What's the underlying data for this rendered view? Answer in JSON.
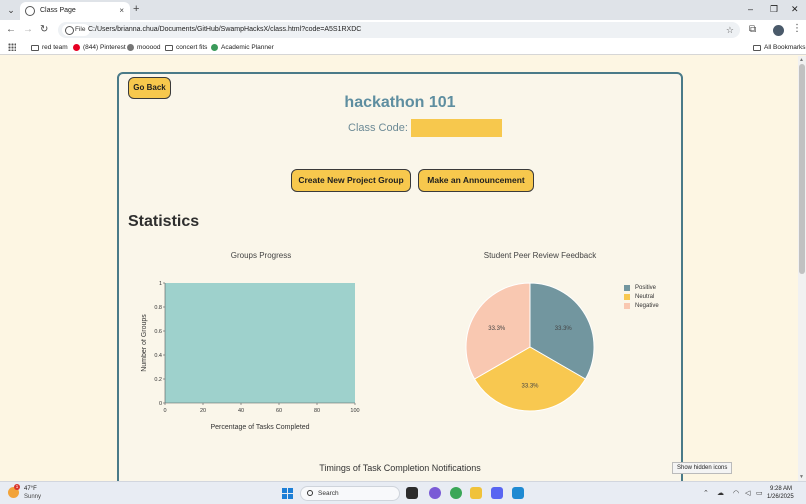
{
  "browser": {
    "tab_title": "Class Page",
    "new_tab": "+",
    "tab_close": "×",
    "url_scheme_label": "File",
    "url": "C:/Users/brianna.chua/Documents/GitHub/SwampHacksX/class.html?code=A5S1RXDC",
    "window_controls": [
      "–",
      "❐",
      "✕"
    ],
    "bookmarks": [
      "red team",
      "(844) Pinterest",
      "mooood",
      "concert fits",
      "Academic Planner"
    ],
    "all_bookmarks": "All Bookmarks"
  },
  "page": {
    "go_back_label": "Go Back",
    "class_title": "hackathon 101",
    "class_code_label": "Class Code:",
    "class_code_value": "",
    "create_group_label": "Create New Project Group",
    "announcement_label": "Make an Announcement",
    "statistics_heading": "Statistics",
    "timings_title": "Timings of Task Completion Notifications"
  },
  "chart_data": [
    {
      "type": "bar",
      "title": "Groups Progress",
      "xlabel": "Percentage of Tasks Completed",
      "ylabel": "Number of Groups",
      "x_ticks": [
        "0",
        "20",
        "40",
        "60",
        "80",
        "100"
      ],
      "y_ticks": [
        "0",
        "0.2",
        "0.4",
        "0.6",
        "0.8",
        "1"
      ],
      "xlim": [
        0,
        100
      ],
      "ylim": [
        0,
        1
      ],
      "bars": [
        {
          "x_start": 0,
          "x_end": 100,
          "value": 1
        }
      ],
      "color": "#9ed1cc",
      "grid": false
    },
    {
      "type": "pie",
      "title": "Student Peer Review Feedback",
      "slices": [
        {
          "label": "Positive",
          "value": 33.3,
          "color": "#72969f",
          "text": "33.3%"
        },
        {
          "label": "Neutral",
          "value": 33.3,
          "color": "#f8c850",
          "text": "33.3%"
        },
        {
          "label": "Negative",
          "value": 33.3,
          "color": "#f9c8b1",
          "text": "33.3%"
        }
      ],
      "legend_position": "top-right"
    }
  ],
  "tooltip": "Show hidden icons",
  "taskbar": {
    "weather_badge": "1",
    "weather_temp": "47°F",
    "weather_cond": "Sunny",
    "search_label": "Search",
    "time": "9:28 AM",
    "date": "1/26/2025"
  },
  "colors": {
    "accent": "#f7c84d",
    "title_teal": "#5e8ea0",
    "card_border": "#4a7a88",
    "page_background": "#fdf6e3"
  }
}
